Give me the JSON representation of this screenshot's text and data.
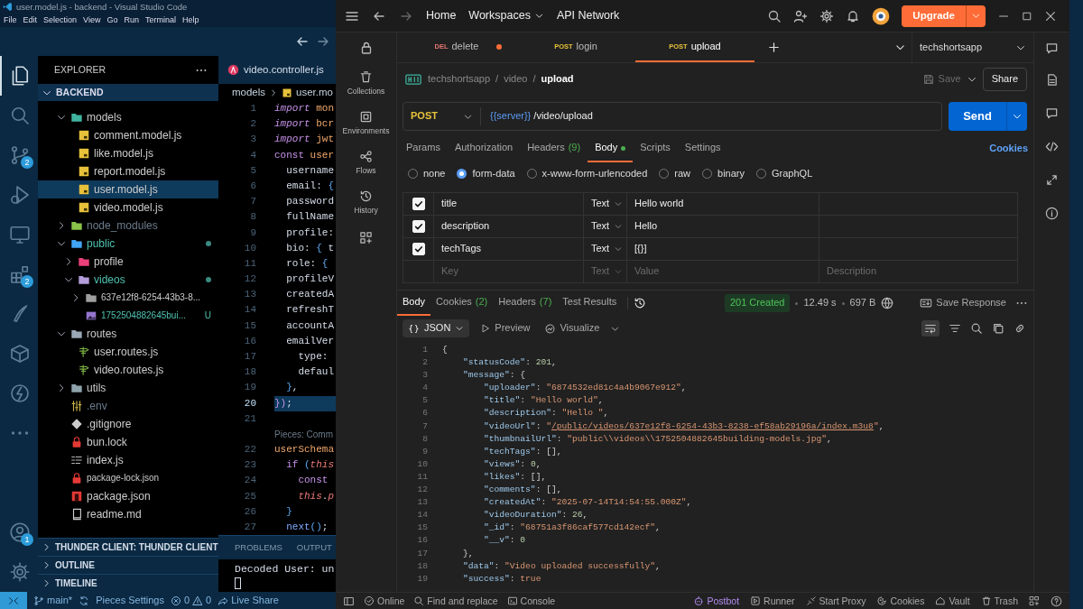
{
  "vscode": {
    "window_title": "user.model.js - backend - Visual Studio Code",
    "menu": [
      "File",
      "Edit",
      "Selection",
      "View",
      "Go",
      "Run",
      "Terminal",
      "Help"
    ],
    "activity_bar": [
      {
        "kind": "files",
        "selected": true
      },
      {
        "kind": "search",
        "selected": false
      },
      {
        "kind": "source-control",
        "selected": false,
        "badge": "2"
      },
      {
        "kind": "run-debug",
        "selected": false
      },
      {
        "kind": "remote-explorer",
        "selected": false
      },
      {
        "kind": "extensions",
        "selected": false,
        "badge": "2"
      },
      {
        "kind": "pieces",
        "selected": false
      },
      {
        "kind": "packages",
        "selected": false
      },
      {
        "kind": "thunder-client",
        "selected": false
      },
      {
        "kind": "more",
        "selected": false
      },
      {
        "kind": "accounts",
        "selected": false,
        "badge": "1"
      },
      {
        "kind": "manage",
        "selected": false
      }
    ],
    "explorer": {
      "title": "EXPLORER",
      "root": "BACKEND",
      "tree": [
        {
          "label": "models",
          "kind": "folder-models",
          "expanded": true,
          "selected": false,
          "children": [
            {
              "label": "comment.model.js",
              "kind": "js",
              "selected": false
            },
            {
              "label": "like.model.js",
              "kind": "js",
              "selected": false
            },
            {
              "label": "report.model.js",
              "kind": "js",
              "selected": false
            },
            {
              "label": "user.model.js",
              "kind": "js",
              "selected": true
            },
            {
              "label": "video.model.js",
              "kind": "js",
              "selected": false
            }
          ]
        },
        {
          "label": "node_modules",
          "kind": "folder-node",
          "expanded": false,
          "selected": false,
          "ignored": true
        },
        {
          "label": "public",
          "kind": "folder-public",
          "expanded": true,
          "selected": false,
          "modified": true,
          "children": [
            {
              "label": "profile",
              "kind": "folder-profile",
              "expanded": false,
              "selected": false
            },
            {
              "label": "videos",
              "kind": "folder-videos",
              "expanded": true,
              "selected": false,
              "modified": true,
              "children": [
                {
                  "label": "637e12f8-6254-43b3-8...",
                  "kind": "folder",
                  "expanded": false,
                  "selected": false
                },
                {
                  "label": "1752504882645bui...",
                  "kind": "image",
                  "selected": false,
                  "status": "U"
                }
              ]
            }
          ]
        },
        {
          "label": "routes",
          "kind": "folder-routes",
          "expanded": true,
          "selected": false,
          "children": [
            {
              "label": "user.routes.js",
              "kind": "route",
              "selected": false
            },
            {
              "label": "video.routes.js",
              "kind": "route",
              "selected": false
            }
          ]
        },
        {
          "label": "utils",
          "kind": "folder-utils",
          "expanded": false,
          "selected": false
        },
        {
          "label": ".env",
          "kind": "env",
          "selected": false,
          "ignored": true
        },
        {
          "label": ".gitignore",
          "kind": "git",
          "selected": false
        },
        {
          "label": "bun.lock",
          "kind": "lock",
          "selected": false
        },
        {
          "label": "index.js",
          "kind": "index",
          "selected": false
        },
        {
          "label": "package-lock.json",
          "kind": "lock",
          "selected": false
        },
        {
          "label": "package.json",
          "kind": "npm",
          "selected": false
        },
        {
          "label": "readme.md",
          "kind": "readme",
          "selected": false
        }
      ],
      "sections": [
        "THUNDER CLIENT: THUNDER CLIENT",
        "OUTLINE",
        "TIMELINE"
      ]
    },
    "editor": {
      "tab": "video.controller.js",
      "breadcrumb": [
        "models",
        "user.mo"
      ],
      "lines": [
        {
          "kind": "code",
          "number": "1",
          "tokens": [
            {
              "kind": "kw",
              "text": "import"
            },
            {
              "kind": "id",
              "text": " mon"
            }
          ]
        },
        {
          "kind": "code",
          "number": "2",
          "tokens": [
            {
              "kind": "kw",
              "text": "import"
            },
            {
              "kind": "id",
              "text": " bcr"
            }
          ]
        },
        {
          "kind": "code",
          "number": "3",
          "tokens": [
            {
              "kind": "kw",
              "text": "import"
            },
            {
              "kind": "id",
              "text": " jwt"
            }
          ]
        },
        {
          "kind": "code",
          "number": "4",
          "tokens": [
            {
              "kind": "kw2",
              "text": "const"
            },
            {
              "kind": "id",
              "text": " user"
            }
          ]
        },
        {
          "kind": "code",
          "number": "5",
          "tokens": [
            {
              "kind": "prop",
              "text": "  username"
            }
          ]
        },
        {
          "kind": "code",
          "number": "6",
          "tokens": [
            {
              "kind": "prop",
              "text": "  email"
            },
            {
              "kind": "pl",
              "text": ": "
            },
            {
              "kind": "br",
              "text": "{"
            }
          ]
        },
        {
          "kind": "code",
          "number": "7",
          "tokens": [
            {
              "kind": "prop",
              "text": "  password"
            }
          ]
        },
        {
          "kind": "code",
          "number": "8",
          "tokens": [
            {
              "kind": "prop",
              "text": "  fullName"
            }
          ]
        },
        {
          "kind": "code",
          "number": "9",
          "tokens": [
            {
              "kind": "prop",
              "text": "  profile:"
            }
          ]
        },
        {
          "kind": "code",
          "number": "10",
          "tokens": [
            {
              "kind": "prop",
              "text": "  bio"
            },
            {
              "kind": "pl",
              "text": ": "
            },
            {
              "kind": "br",
              "text": "{"
            },
            {
              "kind": "pl",
              "text": " t"
            }
          ]
        },
        {
          "kind": "code",
          "number": "11",
          "tokens": [
            {
              "kind": "prop",
              "text": "  role"
            },
            {
              "kind": "pl",
              "text": ": "
            },
            {
              "kind": "br",
              "text": "{"
            }
          ]
        },
        {
          "kind": "code",
          "number": "12",
          "tokens": [
            {
              "kind": "prop",
              "text": "  profileV"
            }
          ]
        },
        {
          "kind": "code",
          "number": "13",
          "tokens": [
            {
              "kind": "prop",
              "text": "  createdA"
            }
          ]
        },
        {
          "kind": "code",
          "number": "14",
          "tokens": [
            {
              "kind": "prop",
              "text": "  refreshT"
            }
          ]
        },
        {
          "kind": "code",
          "number": "15",
          "tokens": [
            {
              "kind": "prop",
              "text": "  accountA"
            }
          ]
        },
        {
          "kind": "code",
          "number": "16",
          "tokens": [
            {
              "kind": "prop",
              "text": "  emailVer"
            }
          ]
        },
        {
          "kind": "code",
          "number": "17",
          "tokens": [
            {
              "kind": "prop",
              "text": "    type:"
            }
          ]
        },
        {
          "kind": "code",
          "number": "18",
          "tokens": [
            {
              "kind": "prop",
              "text": "    defaul"
            }
          ]
        },
        {
          "kind": "code",
          "number": "19",
          "tokens": [
            {
              "kind": "br",
              "text": "  }"
            },
            {
              "kind": "pl",
              "text": ","
            }
          ]
        },
        {
          "kind": "code",
          "number": "20",
          "current": true,
          "tokens": [
            {
              "kind": "br2",
              "text": "})"
            },
            {
              "kind": "pl",
              "text": ";"
            }
          ]
        },
        {
          "kind": "code",
          "number": "21"
        },
        {
          "kind": "lens",
          "text": "Pieces: Comm"
        },
        {
          "kind": "code",
          "number": "22",
          "tokens": [
            {
              "kind": "id",
              "text": "userSchema"
            }
          ]
        },
        {
          "kind": "code",
          "number": "23",
          "tokens": [
            {
              "kind": "kw2",
              "text": "  if"
            },
            {
              "kind": "br",
              "text": " ("
            },
            {
              "kind": "this",
              "text": "this"
            }
          ]
        },
        {
          "kind": "code",
          "number": "24",
          "tokens": [
            {
              "kind": "kw2",
              "text": "    const"
            }
          ]
        },
        {
          "kind": "code",
          "number": "25",
          "tokens": [
            {
              "kind": "this",
              "text": "    this"
            },
            {
              "kind": "pl",
              "text": "."
            },
            {
              "kind": "this",
              "text": "p"
            }
          ]
        },
        {
          "kind": "code",
          "number": "26",
          "tokens": [
            {
              "kind": "br",
              "text": "  }"
            }
          ]
        },
        {
          "kind": "code",
          "number": "27",
          "tokens": [
            {
              "kind": "fn",
              "text": "  next"
            },
            {
              "kind": "br",
              "text": "()"
            },
            {
              "kind": "pl",
              "text": ";"
            }
          ]
        }
      ]
    },
    "panel": {
      "tabs": [
        "PROBLEMS",
        "OUTPUT"
      ],
      "terminal": "Decoded User: un"
    },
    "status_bar": {
      "branch": "main*",
      "pieces": "Pieces Settings",
      "errors": "0",
      "warnings": "0",
      "live_share": "Live Share"
    }
  },
  "postman": {
    "nav": [
      "Home",
      "Workspaces",
      "API Network"
    ],
    "upgrade": "Upgrade",
    "tabs": [
      {
        "method": "DEL",
        "name": "delete",
        "selected": false,
        "unsaved": true
      },
      {
        "method": "POST",
        "name": "login",
        "selected": false,
        "unsaved": false
      },
      {
        "method": "POST",
        "name": "upload",
        "selected": true,
        "unsaved": false
      }
    ],
    "environment": "techshortsapp",
    "sidebar": [
      {
        "kind": "collections",
        "label": "Collections"
      },
      {
        "kind": "environments",
        "label": "Environments"
      },
      {
        "kind": "flows",
        "label": "Flows"
      },
      {
        "kind": "history",
        "label": "History"
      }
    ],
    "breadcrumb": [
      "techshortsapp",
      "/",
      "video",
      "/",
      "upload"
    ],
    "save": "Save",
    "share": "Share",
    "request": {
      "method": "POST",
      "variable": "{{server}}",
      "path": " /video/upload",
      "send": "Send"
    },
    "request_tabs": [
      {
        "label": "Params",
        "selected": false
      },
      {
        "label": "Authorization",
        "selected": false
      },
      {
        "label": "Headers",
        "count": "(9)",
        "selected": false
      },
      {
        "label": "Body",
        "selected": true,
        "dot": true
      },
      {
        "label": "Scripts",
        "selected": false
      },
      {
        "label": "Settings",
        "selected": false
      }
    ],
    "cookies_link": "Cookies",
    "body_types": [
      {
        "label": "none",
        "selected": false
      },
      {
        "label": "form-data",
        "selected": true
      },
      {
        "label": "x-www-form-urlencoded",
        "selected": false
      },
      {
        "label": "raw",
        "selected": false
      },
      {
        "label": "binary",
        "selected": false
      },
      {
        "label": "GraphQL",
        "selected": false
      }
    ],
    "form_rows": [
      {
        "checked": true,
        "key": "title",
        "type": "Text",
        "value": "Hello world"
      },
      {
        "checked": true,
        "key": "description",
        "type": "Text",
        "value": "Hello "
      },
      {
        "checked": true,
        "key": "techTags",
        "type": "Text",
        "value": "[{}]"
      }
    ],
    "new_row": {
      "key_placeholder": "Key",
      "type": "Text",
      "value_placeholder": "Value",
      "description_placeholder": "Description"
    },
    "response_tabs": [
      {
        "label": "Body",
        "selected": true
      },
      {
        "label": "Cookies",
        "count": "(2)",
        "selected": false
      },
      {
        "label": "Headers",
        "count": "(7)",
        "selected": false
      },
      {
        "label": "Test Results",
        "selected": false
      }
    ],
    "response_status": {
      "status": "201 Created",
      "time": "12.49 s",
      "size": "697 B",
      "save_response": "Save Response"
    },
    "response_view": {
      "format": "JSON",
      "preview": "Preview",
      "visualize": "Visualize"
    },
    "response_lines": [
      {
        "number": "1",
        "tokens": [
          {
            "kind": "p",
            "text": "{"
          }
        ]
      },
      {
        "number": "2",
        "tokens": [
          {
            "kind": "k",
            "text": "    \"statusCode\""
          },
          {
            "kind": "p",
            "text": ": "
          },
          {
            "kind": "n",
            "text": "201"
          },
          {
            "kind": "p",
            "text": ","
          }
        ]
      },
      {
        "number": "3",
        "tokens": [
          {
            "kind": "k",
            "text": "    \"message\""
          },
          {
            "kind": "p",
            "text": ": {"
          }
        ]
      },
      {
        "number": "4",
        "tokens": [
          {
            "kind": "k",
            "text": "        \"uploader\""
          },
          {
            "kind": "p",
            "text": ": "
          },
          {
            "kind": "s",
            "text": "\"6874532ed81c4a4b9067e912\""
          },
          {
            "kind": "p",
            "text": ","
          }
        ]
      },
      {
        "number": "5",
        "tokens": [
          {
            "kind": "k",
            "text": "        \"title\""
          },
          {
            "kind": "p",
            "text": ": "
          },
          {
            "kind": "s",
            "text": "\"Hello world\""
          },
          {
            "kind": "p",
            "text": ","
          }
        ]
      },
      {
        "number": "6",
        "tokens": [
          {
            "kind": "k",
            "text": "        \"description\""
          },
          {
            "kind": "p",
            "text": ": "
          },
          {
            "kind": "s",
            "text": "\"Hello \""
          },
          {
            "kind": "p",
            "text": ","
          }
        ]
      },
      {
        "number": "7",
        "tokens": [
          {
            "kind": "k",
            "text": "        \"videoUrl\""
          },
          {
            "kind": "p",
            "text": ": "
          },
          {
            "kind": "s",
            "text": "\""
          },
          {
            "kind": "u",
            "text": "/public/videos/637e12f8-6254-43b3-8238-ef58ab29196a/index.m3u8"
          },
          {
            "kind": "s",
            "text": "\""
          },
          {
            "kind": "p",
            "text": ","
          }
        ]
      },
      {
        "number": "8",
        "tokens": [
          {
            "kind": "k",
            "text": "        \"thumbnailUrl\""
          },
          {
            "kind": "p",
            "text": ": "
          },
          {
            "kind": "s",
            "text": "\"public\\\\videos\\\\1752504882645building-models.jpg\""
          },
          {
            "kind": "p",
            "text": ","
          }
        ]
      },
      {
        "number": "9",
        "tokens": [
          {
            "kind": "k",
            "text": "        \"techTags\""
          },
          {
            "kind": "p",
            "text": ": [],"
          }
        ]
      },
      {
        "number": "10",
        "tokens": [
          {
            "kind": "k",
            "text": "        \"views\""
          },
          {
            "kind": "p",
            "text": ": "
          },
          {
            "kind": "n",
            "text": "0"
          },
          {
            "kind": "p",
            "text": ","
          }
        ]
      },
      {
        "number": "11",
        "tokens": [
          {
            "kind": "k",
            "text": "        \"likes\""
          },
          {
            "kind": "p",
            "text": ": [],"
          }
        ]
      },
      {
        "number": "12",
        "tokens": [
          {
            "kind": "k",
            "text": "        \"comments\""
          },
          {
            "kind": "p",
            "text": ": [],"
          }
        ]
      },
      {
        "number": "13",
        "tokens": [
          {
            "kind": "k",
            "text": "        \"createdAt\""
          },
          {
            "kind": "p",
            "text": ": "
          },
          {
            "kind": "s",
            "text": "\"2025-07-14T14:54:55.000Z\""
          },
          {
            "kind": "p",
            "text": ","
          }
        ]
      },
      {
        "number": "14",
        "tokens": [
          {
            "kind": "k",
            "text": "        \"videoDuration\""
          },
          {
            "kind": "p",
            "text": ": "
          },
          {
            "kind": "n",
            "text": "26"
          },
          {
            "kind": "p",
            "text": ","
          }
        ]
      },
      {
        "number": "15",
        "tokens": [
          {
            "kind": "k",
            "text": "        \"_id\""
          },
          {
            "kind": "p",
            "text": ": "
          },
          {
            "kind": "s",
            "text": "\"68751a3f86caf577cd142ecf\""
          },
          {
            "kind": "p",
            "text": ","
          }
        ]
      },
      {
        "number": "16",
        "tokens": [
          {
            "kind": "k",
            "text": "        \"__v\""
          },
          {
            "kind": "p",
            "text": ": "
          },
          {
            "kind": "n",
            "text": "0"
          }
        ]
      },
      {
        "number": "17",
        "tokens": [
          {
            "kind": "p",
            "text": "    },"
          }
        ]
      },
      {
        "number": "18",
        "tokens": [
          {
            "kind": "k",
            "text": "    \"data\""
          },
          {
            "kind": "p",
            "text": ": "
          },
          {
            "kind": "s",
            "text": "\"Video uploaded successfully\""
          },
          {
            "kind": "p",
            "text": ","
          }
        ]
      },
      {
        "number": "19",
        "tokens": [
          {
            "kind": "k",
            "text": "    \"success\""
          },
          {
            "kind": "p",
            "text": ": "
          },
          {
            "kind": "s",
            "text": "true"
          }
        ]
      }
    ],
    "status_left": [
      {
        "kind": "online",
        "label": "Online"
      },
      {
        "kind": "find",
        "label": "Find and replace"
      },
      {
        "kind": "console",
        "label": "Console"
      }
    ],
    "status_right": [
      {
        "kind": "postbot",
        "label": "Postbot"
      },
      {
        "kind": "runner",
        "label": "Runner"
      },
      {
        "kind": "proxy",
        "label": "Start Proxy"
      },
      {
        "kind": "cookies",
        "label": "Cookies"
      },
      {
        "kind": "vault",
        "label": "Vault"
      },
      {
        "kind": "trash",
        "label": "Trash"
      }
    ]
  }
}
